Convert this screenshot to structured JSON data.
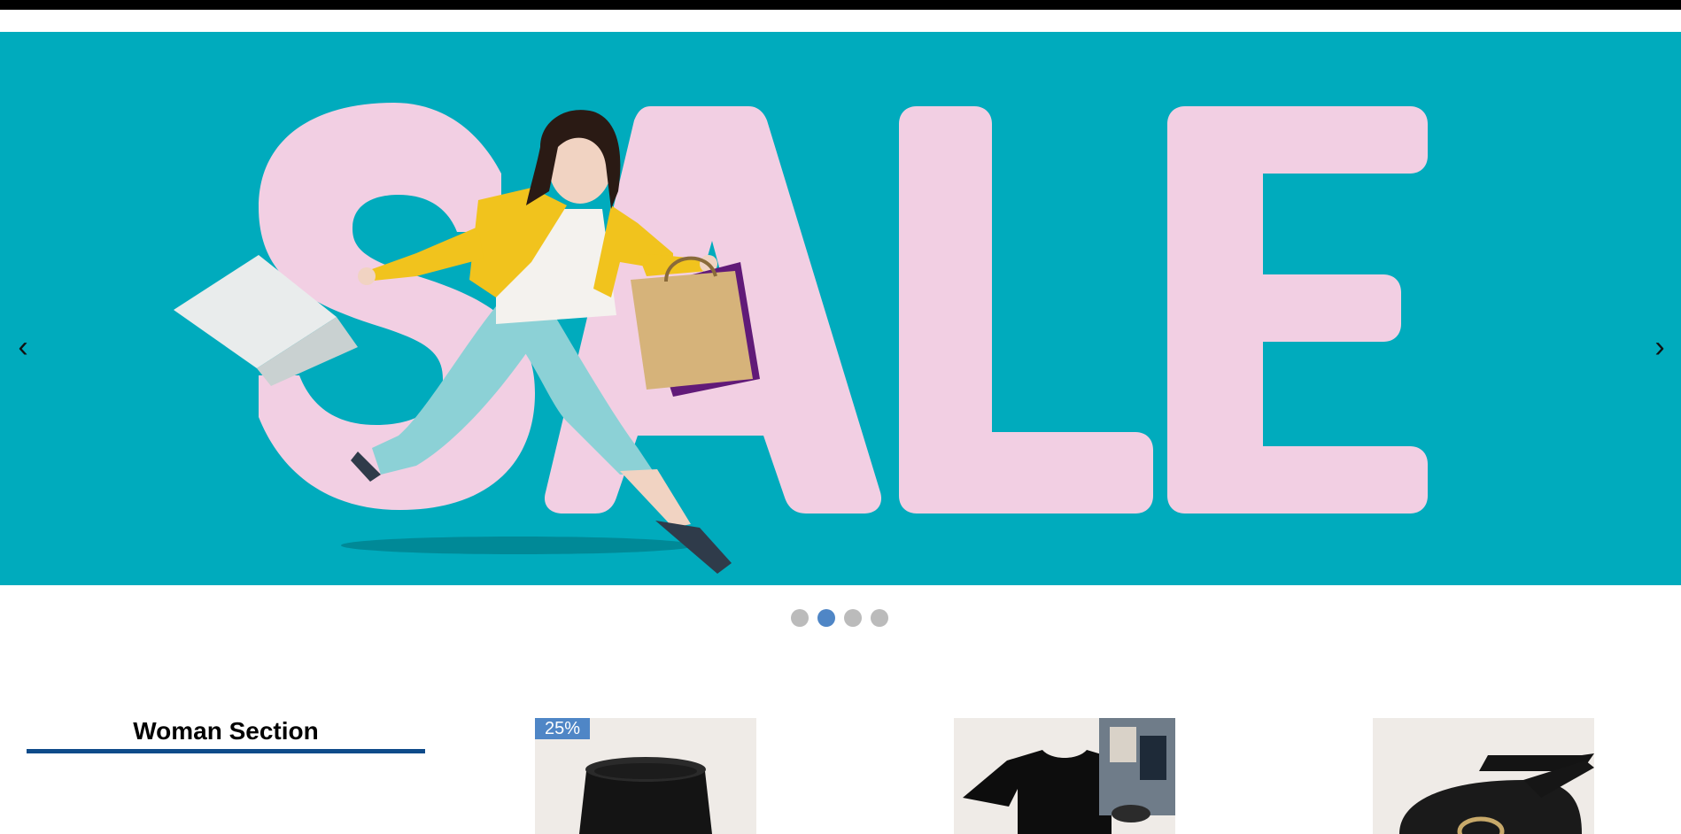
{
  "hero": {
    "carousel": {
      "prev_label": "‹",
      "next_label": "›",
      "slide_count": 4,
      "active_slide_index": 1
    },
    "banner_text": "SALE",
    "colors": {
      "background": "#00abbd",
      "letters": "#f2cfe3",
      "jacket": "#f1c31d",
      "pants": "#8cd1d6"
    }
  },
  "colors": {
    "accent": "#4f86c6",
    "underline": "#0e4b8a",
    "topbar": "#000000",
    "card_bg": "#efebe7"
  },
  "section": {
    "title": "Woman Section"
  },
  "products": [
    {
      "badge": "25%",
      "icon": "bucket-hat-icon"
    },
    {
      "badge": "",
      "icon": "black-tshirt-icon"
    },
    {
      "badge": "",
      "icon": "black-belt-icon"
    }
  ]
}
